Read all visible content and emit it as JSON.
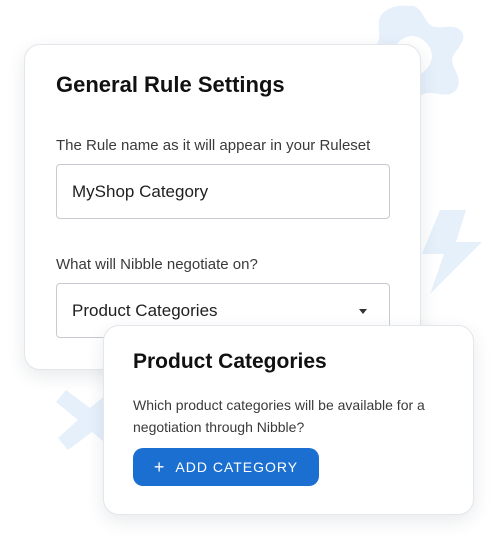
{
  "main_card": {
    "title": "General Rule Settings",
    "rule_name_label": "The Rule name as it will appear in your Ruleset",
    "rule_name_value": "MyShop Category",
    "negotiate_label": "What will Nibble negotiate on?",
    "negotiate_value": "Product Categories"
  },
  "sub_card": {
    "title": "Product Categories",
    "description": "Which product categories will be available for a negotiation through Nibble?",
    "add_button_label": "ADD CATEGORY",
    "add_button_icon": "+"
  },
  "colors": {
    "accent": "#1a6fd1",
    "decoration": "#e6f0fb"
  },
  "icons": {
    "decorations": [
      "star-shape-icon",
      "lightning-bolt-icon",
      "cross-shape-icon"
    ],
    "dropdown": "caret-down-icon",
    "button": "plus-icon"
  }
}
